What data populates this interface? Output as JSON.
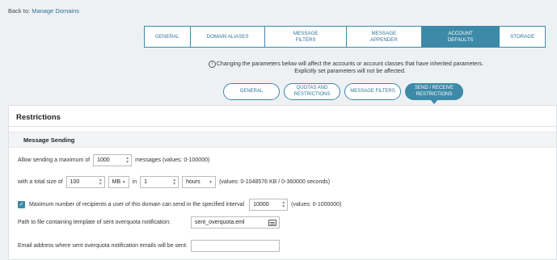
{
  "breadcrumb": {
    "prefix": "Back to:",
    "link": "Manage Domains"
  },
  "tabs": [
    {
      "label": "GENERAL"
    },
    {
      "label": "DOMAIN ALIASES"
    },
    {
      "label": "MESSAGE FILTERS"
    },
    {
      "label": "MESSAGE APPENDER"
    },
    {
      "label": "ACCOUNT DEFAULTS",
      "active": true
    },
    {
      "label": "STORAGE"
    }
  ],
  "info": {
    "line1": "Changing the parameters below will affect the accounts or account classes that have inherited parameters.",
    "line2": "Explicitly set parameters will not be affected."
  },
  "subtabs": [
    {
      "label": "GENERAL"
    },
    {
      "label": "QUOTAS AND RESTRICTIONS"
    },
    {
      "label": "MESSAGE FILTERS"
    },
    {
      "label": "SEND / RECEIVE RESTRICTIONS",
      "active": true
    }
  ],
  "panel": {
    "title": "Restrictions",
    "section_title": "Message Sending",
    "row1": {
      "prefix": "Allow sending a maximum of",
      "value": "1000",
      "suffix": "messages (values: 0-100000)"
    },
    "row2": {
      "prefix": "with a total size of",
      "size_value": "100",
      "size_unit": "MB",
      "in_label": "in",
      "time_value": "1",
      "time_unit": "hours",
      "suffix": "(values: 0-1048576 KB / 0-360000 seconds)"
    },
    "row3": {
      "checked": true,
      "label": "Maximum number of recipients a user of this domain can send in the specified interval",
      "value": "10000",
      "suffix": "(values: 0-1000000)"
    },
    "row4": {
      "label": "Path to file containing template of sent overquota notification:",
      "value": "sent_overquota.eml"
    },
    "row5": {
      "label": "Email address where sent overquota notification emails will be sent:",
      "value": ""
    }
  }
}
